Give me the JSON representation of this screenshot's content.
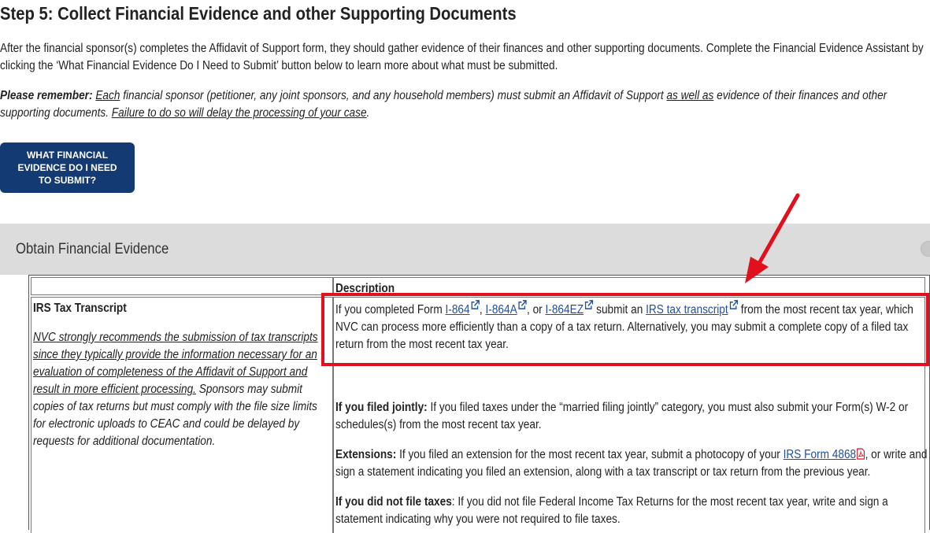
{
  "step": {
    "title": "Step 5: Collect Financial Evidence and other Supporting Documents"
  },
  "intro": {
    "line1": "After the financial sponsor(s) completes the Affidavit of Support form, they should gather evidence of their finances and other supporting documents. Complete the Financial Evidence Assistant by",
    "line2": "clicking the ‘What Financial Evidence Do I Need to Submit’ button below to learn more about what must be submitted."
  },
  "reminder": {
    "lead": "Please remember:",
    "each": "Each",
    "text_a": " financial sponsor (petitioner, any joint sponsors, and any household members) must submit an Affidavit of Support ",
    "as_well_as": "as well as",
    "text_b": " evidence of their finances and other supporting documents. ",
    "failure": "Failure to do so will delay the processing of your case",
    "end": "."
  },
  "cta": {
    "label": "WHAT FINANCIAL EVIDENCE DO I NEED TO SUBMIT?"
  },
  "accordion": {
    "title": "Obtain Financial Evidence"
  },
  "table": {
    "header_col1": "",
    "header_col2": "Description",
    "row1": {
      "label": "IRS Tax Transcript",
      "note_underlined": "NVC strongly recommends the submission of tax transcripts since they typically provide the information necessary for an evaluation of completeness of the Affidavit of Support and result in more efficient processing.",
      "note_rest": "  Sponsors may submit copies of tax returns but must comply with the file size limits for electronic uploads to CEAC and could be delayed by requests for additional documentation.",
      "desc1": {
        "pre": "If you completed Form ",
        "link_i864": "I-864",
        "sep1": ", ",
        "link_i864a": "I-864A",
        "sep2": ", or ",
        "link_i864ez": "I-864EZ",
        "mid": " submit an ",
        "link_irs": "IRS tax transcript",
        "post": " from the most recent tax year, which NVC can process more efficiently than a copy of a tax return.  Alternatively, you may submit a complete copy of a filed tax return from the most recent tax year."
      },
      "desc2": {
        "lead": "If you filed jointly:",
        "text": " If you filed taxes under the “married filing jointly” category, you must also submit your Form(s) W-2 or schedules(s) from the most recent tax year."
      },
      "desc3": {
        "lead": "Extensions:",
        "pre": " If you filed an extension for the most recent tax year, submit a photocopy of your ",
        "link": "IRS Form 4868",
        "post": ", or write and sign a statement indicating you filed an extension, along with a tax transcript or tax return from the previous year."
      },
      "desc4": {
        "lead": "If you did not file taxes",
        "text": ": If you did not file Federal Income Tax Returns for the most recent tax year, write and sign a statement indicating why you were not required to file taxes."
      }
    }
  },
  "colors": {
    "button_bg": "#133a72",
    "link": "#1f4e9d",
    "highlight": "#e0101e",
    "accordion_bg": "#dcdcdc"
  },
  "icons": {
    "external": "external-link-icon",
    "pdf": "pdf-icon",
    "annotation_arrow": "red-arrow-annotation"
  }
}
